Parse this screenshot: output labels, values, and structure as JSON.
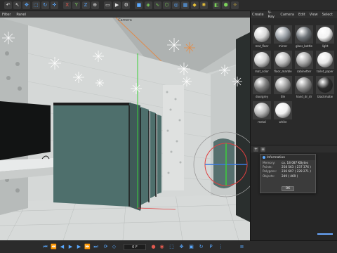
{
  "viewport": {
    "menu": [
      "Filter",
      "Panel"
    ],
    "camera_label": "Camera"
  },
  "side_panel": {
    "menu": [
      "Create",
      "V-Ray",
      "Camera",
      "Edit",
      "View",
      "Select"
    ],
    "materials": [
      {
        "label": "mat_floor",
        "color": "#d9d9d9"
      },
      {
        "label": "mirror",
        "color": "#9aa0a6"
      },
      {
        "label": "glass_bottle",
        "color": "#6e7378"
      },
      {
        "label": "light",
        "color": "#f2f2f2"
      },
      {
        "label": "mat_color",
        "color": "#cfcfcf"
      },
      {
        "label": "floor_marble",
        "color": "#bdbdbd"
      },
      {
        "label": "cabinetter",
        "color": "#a9a9a9"
      },
      {
        "label": "toilet_paper",
        "color": "#e8e8e8"
      },
      {
        "label": "doorgrey",
        "color": "#7c7c7c"
      },
      {
        "label": "tile",
        "color": "#9e9e9e"
      },
      {
        "label": "hand_dr_dr",
        "color": "#8a8a8a"
      },
      {
        "label": "blackmatw",
        "color": "#2a2a2a"
      },
      {
        "label": "metal",
        "color": "#b7b7b7"
      },
      {
        "label": "white",
        "color": "#f0f0f0"
      }
    ]
  },
  "info_dialog": {
    "title": "Information",
    "rows": [
      {
        "key": "Memory:",
        "value": "ca. 18 087 KBytes"
      },
      {
        "key": "Points:",
        "value": "258 563 ( 237 376 )"
      },
      {
        "key": "Polygons:",
        "value": "236 607 ( 228 271 )"
      },
      {
        "key": "Objects:",
        "value": "249 ( 469 )"
      }
    ],
    "ok_label": "OK"
  },
  "timeline": {
    "frame": "0 F"
  },
  "colors": {
    "accent": "#5aa9ff",
    "stall_door": "#4e6f6c"
  }
}
